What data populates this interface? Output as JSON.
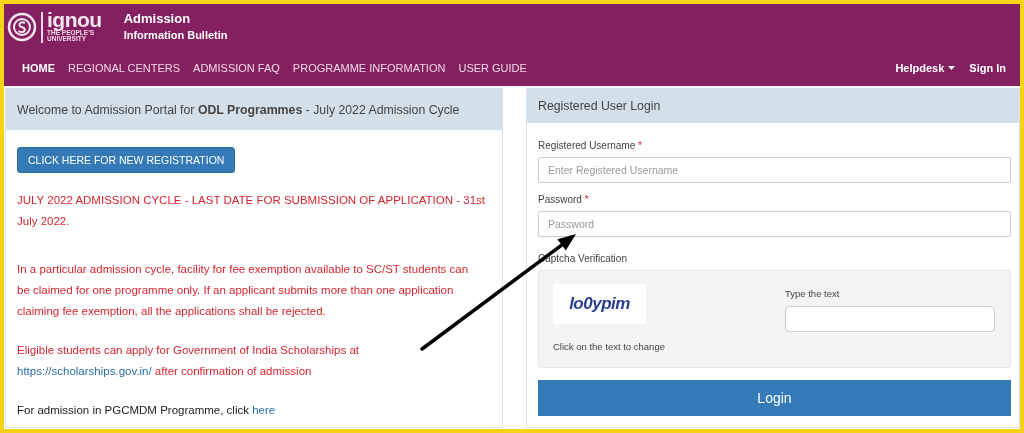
{
  "brand": {
    "wordmark": "ignou",
    "tagline_1": "THE PEOPLE'S",
    "tagline_2": "UNIVERSITY",
    "title": "Admission",
    "subtitle": "Information Bulletin"
  },
  "nav": [
    {
      "label": "HOME",
      "selected": true
    },
    {
      "label": "REGIONAL CENTERS",
      "selected": false
    },
    {
      "label": "ADMISSION FAQ",
      "selected": false
    },
    {
      "label": "PROGRAMME INFORMATION",
      "selected": false
    },
    {
      "label": "USER GUIDE",
      "selected": false
    }
  ],
  "nav_right": [
    {
      "label": "Helpdesk",
      "kind": "dropdown"
    },
    {
      "label": "Sign In",
      "kind": "link"
    }
  ],
  "welcome": {
    "heading": "Welcome to Admission Portal for **ODL Programmes** - July 2022 Admission Cycle",
    "register_button": "CLICK HERE FOR NEW REGISTRATION",
    "notices": [
      {
        "kind": "alert",
        "text": "JULY 2022 ADMISSION CYCLE - LAST DATE FOR SUBMISSION OF APPLICATION - 31st July 2022."
      },
      {
        "kind": "alert",
        "text": "In a particular admission cycle, facility for fee exemption available to SC/ST students can be claimed for one programme only. If an applicant submits more than one application claiming fee exemption, all the applications shall be rejected."
      },
      {
        "kind": "alert",
        "text": "Eligible students can apply for Government of India Scholarships at ",
        "link": "https://scholarships.gov.in/",
        "after": " after confirmation of admission"
      },
      {
        "kind": "info",
        "text": "For admission in PGCMDM Programme, click ",
        "link": "here"
      }
    ]
  },
  "login": {
    "heading": "Registered User Login",
    "fields": [
      {
        "label": "Registered Username",
        "required": true,
        "required_mark": "*",
        "placeholder": "Enter Registered Username"
      },
      {
        "label": "Password",
        "required": true,
        "required_mark": "*",
        "placeholder": "Password"
      }
    ],
    "captcha": {
      "label": "Captcha Verification",
      "image_text": "lo0ypim",
      "hint": "Click on the text to change",
      "input_label": "Type the text"
    },
    "submit": "Login"
  }
}
